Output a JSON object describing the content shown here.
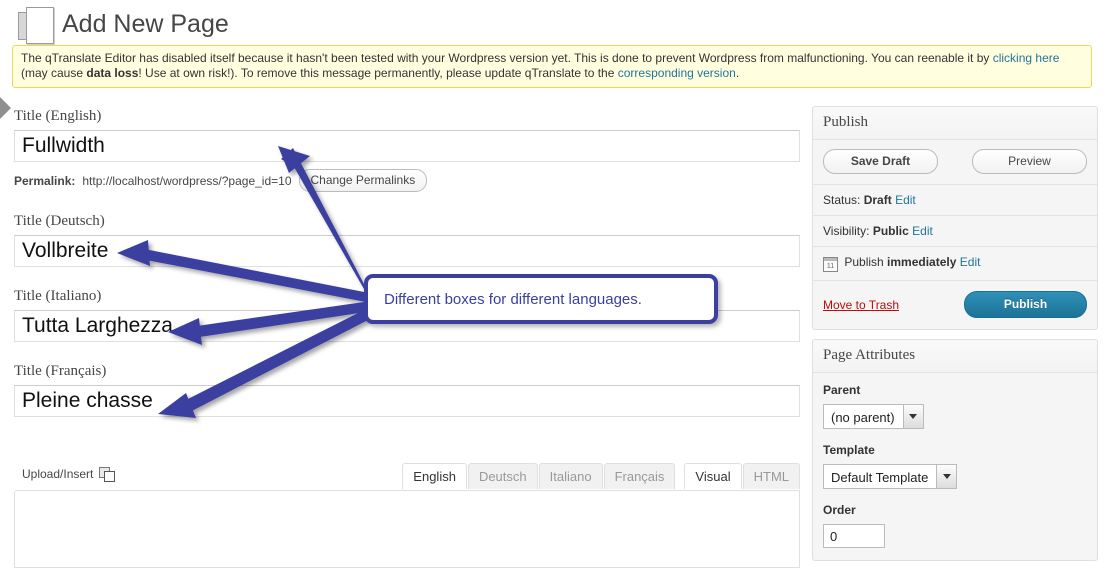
{
  "header": {
    "title": "Add New Page",
    "icon": "page-document-icon"
  },
  "notice": {
    "text_1": "The qTranslate Editor has disabled itself because it hasn't been tested with your Wordpress version yet. This is done to prevent Wordpress from malfunctioning. You can reenable it by ",
    "link_1": "clicking here",
    "text_2": " (may cause ",
    "bold_1": "data loss",
    "text_3": "! Use at own risk!). To remove this message permanently, please update qTranslate to the ",
    "link_2": "corresponding version",
    "text_4": "."
  },
  "titles": [
    {
      "label": "Title (English)",
      "value": "Fullwidth"
    },
    {
      "label": "Title (Deutsch)",
      "value": "Vollbreite"
    },
    {
      "label": "Title (Italiano)",
      "value": "Tutta Larghezza"
    },
    {
      "label": "Title (Français)",
      "value": "Pleine chasse"
    }
  ],
  "permalink": {
    "label": "Permalink:",
    "url": "http://localhost/wordpress/?page_id=10",
    "button": "Change Permalinks"
  },
  "editor": {
    "upload_label": "Upload/Insert",
    "language_tabs": [
      {
        "label": "English",
        "active": true
      },
      {
        "label": "Deutsch",
        "active": false
      },
      {
        "label": "Italiano",
        "active": false
      },
      {
        "label": "Français",
        "active": false
      }
    ],
    "mode_tabs": [
      {
        "label": "Visual",
        "active": true
      },
      {
        "label": "HTML",
        "active": false
      }
    ],
    "content": ""
  },
  "publish": {
    "heading": "Publish",
    "save_draft": "Save Draft",
    "preview": "Preview",
    "status_label": "Status:",
    "status_value": "Draft",
    "status_edit": "Edit",
    "visibility_label": "Visibility:",
    "visibility_value": "Public",
    "visibility_edit": "Edit",
    "publish_label": "Publish",
    "publish_value": "immediately",
    "publish_edit": "Edit",
    "trash": "Move to Trash",
    "publish_button": "Publish"
  },
  "attributes": {
    "heading": "Page Attributes",
    "parent_label": "Parent",
    "parent_value": "(no parent)",
    "template_label": "Template",
    "template_value": "Default Template",
    "order_label": "Order",
    "order_value": "0"
  },
  "annotation": {
    "callout_text": "Different boxes for different languages.",
    "color": "#3b3fa0"
  }
}
